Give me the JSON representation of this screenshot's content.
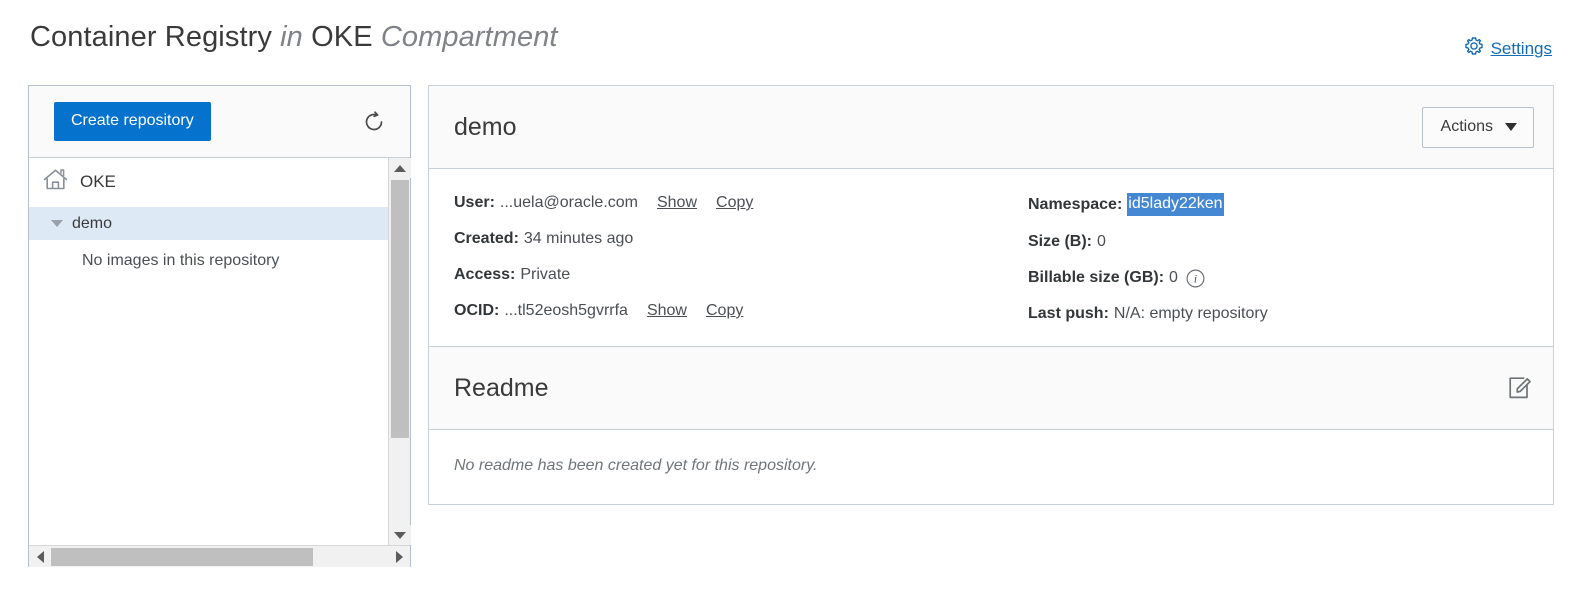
{
  "header": {
    "title_main": "Container Registry",
    "title_in": "in",
    "title_scope": "OKE",
    "title_compartment": "Compartment",
    "settings_label": "Settings",
    "settings_icon": "gear-icon",
    "link_color": "#136cb7"
  },
  "sidebar": {
    "create_button": "Create repository",
    "create_button_color": "#0572ce",
    "refresh_icon": "refresh-icon",
    "tree": {
      "root": {
        "label": "OKE",
        "icon": "home-icon"
      },
      "repository": {
        "label": "demo",
        "selected": true,
        "expanded": true,
        "highlight_color": "#dde9f4"
      },
      "empty_message": "No images in this repository"
    },
    "scrollbar": {
      "up_icon": "arrow-up-icon",
      "down_icon": "arrow-down-icon",
      "left_icon": "arrow-left-icon",
      "right_icon": "arrow-right-icon"
    }
  },
  "main": {
    "repo_title": "demo",
    "actions_button": "Actions",
    "actions_caret_icon": "chevron-down-icon",
    "details": {
      "left": [
        {
          "label": "User:",
          "value": "...uela@oracle.com",
          "links": [
            "Show",
            "Copy"
          ]
        },
        {
          "label": "Created:",
          "value": "34 minutes ago",
          "links": []
        },
        {
          "label": "Access:",
          "value": "Private",
          "links": []
        },
        {
          "label": "OCID:",
          "value": "...tl52eosh5gvrrfa",
          "links": [
            "Show",
            "Copy"
          ]
        }
      ],
      "right": [
        {
          "label": "Namespace:",
          "value": "id5lady22ken",
          "selected": true,
          "info": false
        },
        {
          "label": "Size (B):",
          "value": "0",
          "selected": false,
          "info": false
        },
        {
          "label": "Billable size (GB):",
          "value": "0",
          "selected": false,
          "info": true
        },
        {
          "label": "Last push:",
          "value": "N/A: empty repository",
          "selected": false,
          "info": false
        }
      ],
      "selection_color": "#4488d4"
    },
    "readme": {
      "title": "Readme",
      "edit_icon": "edit-icon",
      "empty_message": "No readme has been created yet for this repository."
    }
  }
}
